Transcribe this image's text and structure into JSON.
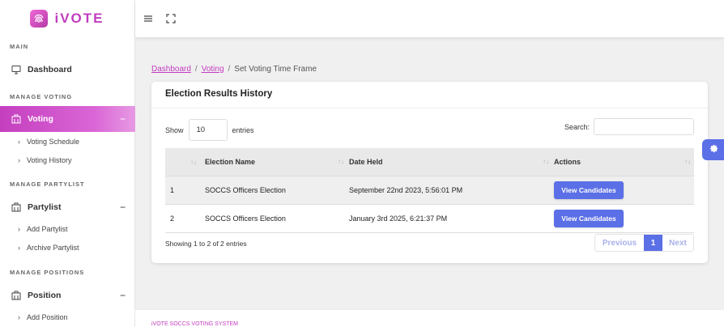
{
  "brand": {
    "name": "iVOTE"
  },
  "sidebar": {
    "sections": {
      "main": "MAIN",
      "manage_voting": "MANAGE VOTING",
      "manage_partylist": "MANAGE PARTYLIST",
      "manage_positions": "MANAGE POSITIONS"
    },
    "dashboard": "Dashboard",
    "voting": {
      "label": "Voting",
      "toggle": "−",
      "items": [
        "Voting Schedule",
        "Voting History"
      ]
    },
    "partylist": {
      "label": "Partylist",
      "toggle": "−",
      "items": [
        "Add Partylist",
        "Archive Partylist"
      ]
    },
    "position": {
      "label": "Position",
      "toggle": "−",
      "items": [
        "Add Position"
      ]
    }
  },
  "breadcrumb": {
    "items": [
      "Dashboard",
      "Voting"
    ],
    "current": "Set Voting Time Frame",
    "separator": "/"
  },
  "card": {
    "title": "Election Results History",
    "show_label": "Show",
    "entries_value": "10",
    "entries_label": "entries",
    "search_label": "Search:",
    "table": {
      "headers": [
        "",
        "Election Name",
        "Date Held",
        "Actions"
      ],
      "rows": [
        {
          "num": "1",
          "name": "SOCCS Officers Election",
          "date": "September 22nd 2023, 5:56:01 PM",
          "action": "View Candidates"
        },
        {
          "num": "2",
          "name": "SOCCS Officers Election",
          "date": "January 3rd 2025, 6:21:37 PM",
          "action": "View Candidates"
        }
      ]
    },
    "info": "Showing 1 to 2 of 2 entries",
    "pagination": {
      "previous": "Previous",
      "current": "1",
      "next": "Next"
    }
  },
  "footer": {
    "text": "iVOTE SOCCS VOTING SYSTEM"
  },
  "colors": {
    "accent": "#c23dbf",
    "primary_button": "#5b6fe6"
  },
  "icons": [
    "fingerprint-logo-icon",
    "monitor-icon",
    "ballot-box-icon",
    "hamburger-menu-icon",
    "fullscreen-icon",
    "gear-icon",
    "sort-icon",
    "chevron-right-icon"
  ]
}
